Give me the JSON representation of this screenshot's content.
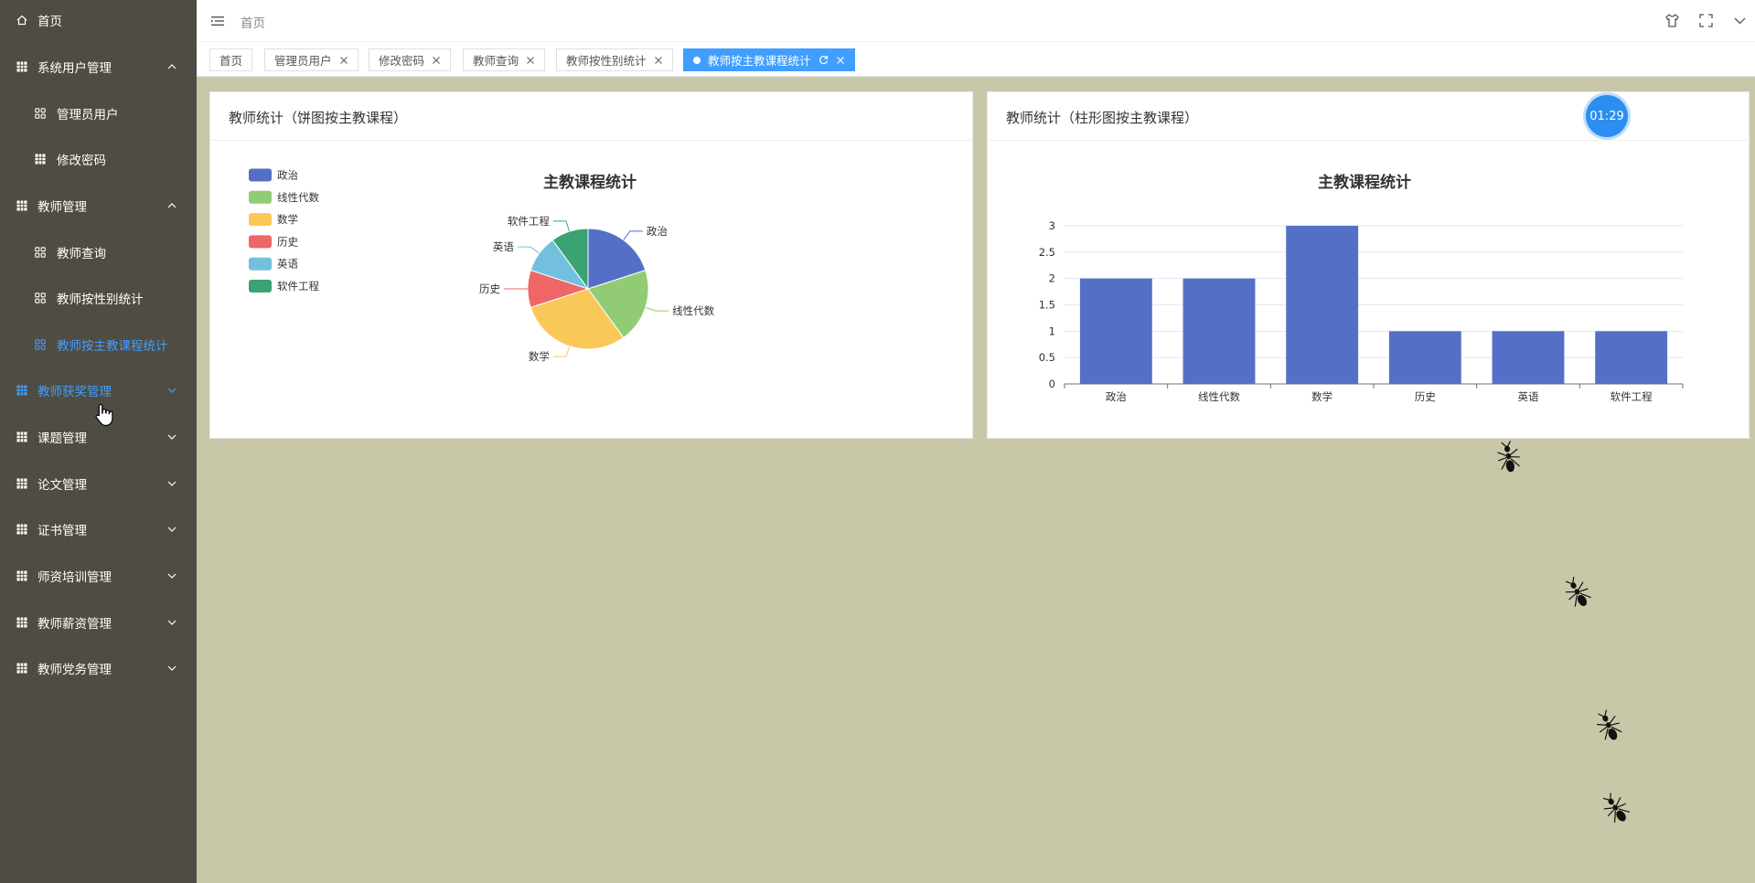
{
  "sidebar": {
    "items": [
      {
        "label": "首页",
        "icon": "home-icon",
        "type": "top",
        "arrow": ""
      },
      {
        "label": "系统用户管理",
        "icon": "grid-icon",
        "type": "top",
        "arrow": "up"
      },
      {
        "label": "管理员用户",
        "icon": "apps-icon",
        "type": "sub",
        "arrow": ""
      },
      {
        "label": "修改密码",
        "icon": "grid-icon",
        "type": "sub",
        "arrow": ""
      },
      {
        "label": "教师管理",
        "icon": "grid-icon",
        "type": "top",
        "arrow": "up"
      },
      {
        "label": "教师查询",
        "icon": "apps-icon",
        "type": "sub",
        "arrow": ""
      },
      {
        "label": "教师按性别统计",
        "icon": "apps-icon",
        "type": "sub",
        "arrow": ""
      },
      {
        "label": "教师按主教课程统计",
        "icon": "apps-icon",
        "type": "sub",
        "arrow": "",
        "active": true
      },
      {
        "label": "教师获奖管理",
        "icon": "grid-icon",
        "type": "top",
        "arrow": "down",
        "active": true
      },
      {
        "label": "课题管理",
        "icon": "grid-icon",
        "type": "top",
        "arrow": "down"
      },
      {
        "label": "论文管理",
        "icon": "grid-icon",
        "type": "top",
        "arrow": "down"
      },
      {
        "label": "证书管理",
        "icon": "grid-icon",
        "type": "top",
        "arrow": "down"
      },
      {
        "label": "师资培训管理",
        "icon": "grid-icon",
        "type": "top",
        "arrow": "down"
      },
      {
        "label": "教师薪资管理",
        "icon": "grid-icon",
        "type": "top",
        "arrow": "down"
      },
      {
        "label": "教师党务管理",
        "icon": "grid-icon",
        "type": "top",
        "arrow": "down"
      }
    ]
  },
  "header": {
    "breadcrumb": "首页"
  },
  "tags": [
    {
      "label": "首页",
      "closable": false
    },
    {
      "label": "管理员用户",
      "closable": true
    },
    {
      "label": "修改密码",
      "closable": true
    },
    {
      "label": "教师查询",
      "closable": true
    },
    {
      "label": "教师按性别统计",
      "closable": true
    },
    {
      "label": "教师按主教课程统计",
      "closable": true,
      "active": true
    }
  ],
  "cards": {
    "pie_title": "教师统计（饼图按主教课程）",
    "bar_title": "教师统计（柱形图按主教课程）"
  },
  "timer": "01:29",
  "colors": {
    "accent": "#409eff",
    "sidebar_bg": "#4f4c43",
    "content_bg": "#c8c8a8"
  },
  "chart_data": [
    {
      "type": "pie",
      "title": "主教课程统计",
      "legend_position": "top-left",
      "categories": [
        "政治",
        "线性代数",
        "数学",
        "历史",
        "英语",
        "软件工程"
      ],
      "values": [
        2,
        2,
        3,
        1,
        1,
        1
      ],
      "colors": [
        "#5470c6",
        "#91cc75",
        "#fac858",
        "#ee6666",
        "#73c0de",
        "#3ba272"
      ]
    },
    {
      "type": "bar",
      "title": "主教课程统计",
      "categories": [
        "政治",
        "线性代数",
        "数学",
        "历史",
        "英语",
        "软件工程"
      ],
      "values": [
        2,
        2,
        3,
        1,
        1,
        1
      ],
      "ylim": [
        0,
        3
      ],
      "yticks": [
        "0",
        "0.5",
        "1",
        "1.5",
        "2",
        "2.5",
        "3"
      ],
      "grid": true,
      "color": "#5470c6"
    }
  ]
}
